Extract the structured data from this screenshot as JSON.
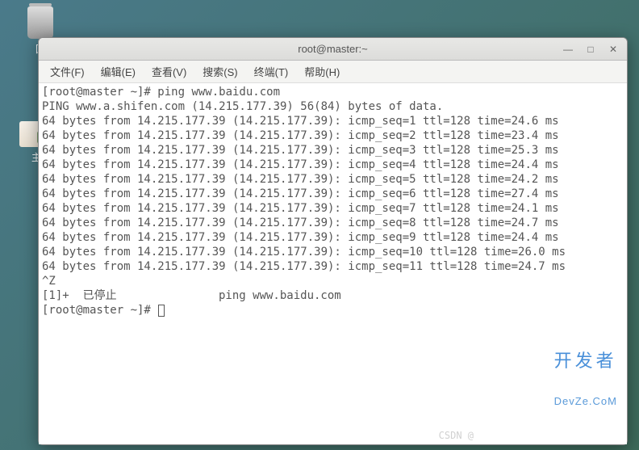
{
  "desktop": {
    "trash_label": "回",
    "home_label": "主"
  },
  "window": {
    "title": "root@master:~"
  },
  "menubar": {
    "file": "文件(F)",
    "edit": "编辑(E)",
    "view": "查看(V)",
    "search": "搜索(S)",
    "terminal": "终端(T)",
    "help": "帮助(H)"
  },
  "terminal": {
    "prompt1": "[root@master ~]# ping www.baidu.com",
    "ping_header": "PING www.a.shifen.com (14.215.177.39) 56(84) bytes of data.",
    "lines": [
      "64 bytes from 14.215.177.39 (14.215.177.39): icmp_seq=1 ttl=128 time=24.6 ms",
      "64 bytes from 14.215.177.39 (14.215.177.39): icmp_seq=2 ttl=128 time=23.4 ms",
      "64 bytes from 14.215.177.39 (14.215.177.39): icmp_seq=3 ttl=128 time=25.3 ms",
      "64 bytes from 14.215.177.39 (14.215.177.39): icmp_seq=4 ttl=128 time=24.4 ms",
      "64 bytes from 14.215.177.39 (14.215.177.39): icmp_seq=5 ttl=128 time=24.2 ms",
      "64 bytes from 14.215.177.39 (14.215.177.39): icmp_seq=6 ttl=128 time=27.4 ms",
      "64 bytes from 14.215.177.39 (14.215.177.39): icmp_seq=7 ttl=128 time=24.1 ms",
      "64 bytes from 14.215.177.39 (14.215.177.39): icmp_seq=8 ttl=128 time=24.7 ms",
      "64 bytes from 14.215.177.39 (14.215.177.39): icmp_seq=9 ttl=128 time=24.4 ms",
      "64 bytes from 14.215.177.39 (14.215.177.39): icmp_seq=10 ttl=128 time=26.0 ms",
      "64 bytes from 14.215.177.39 (14.215.177.39): icmp_seq=11 ttl=128 time=24.7 ms"
    ],
    "suspend": "^Z",
    "stopped": "[1]+  已停止               ping www.baidu.com",
    "prompt2": "[root@master ~]# "
  },
  "watermark": {
    "main": "开发者",
    "sub": "DevZe.CoM",
    "csdn": "CSDN @"
  }
}
